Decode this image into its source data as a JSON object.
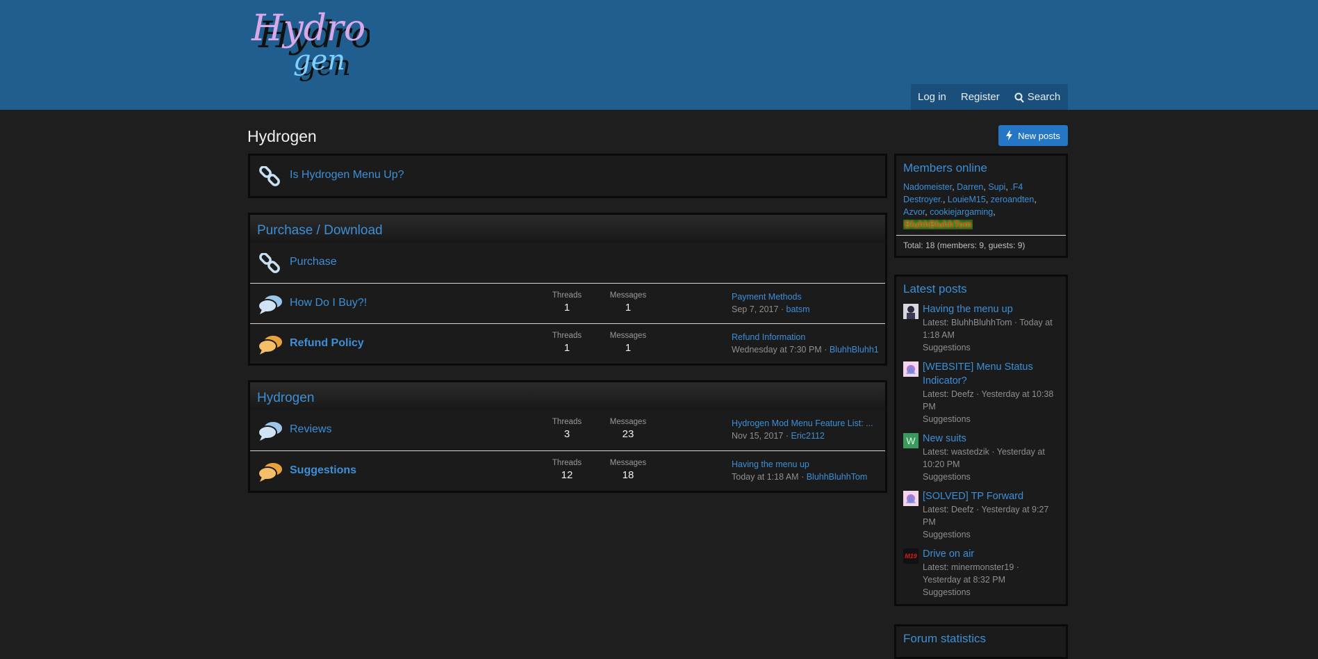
{
  "header": {
    "logo_alt": "Hydrogen",
    "nav": {
      "login": "Log in",
      "register": "Register",
      "search": "Search"
    }
  },
  "page": {
    "title": "Hydrogen",
    "new_posts": "New posts"
  },
  "blocks": [
    {
      "title": "",
      "nodes": [
        {
          "title": "Is Hydrogen Menu Up?",
          "icon": "link-icon",
          "bold": false
        }
      ]
    },
    {
      "title": "Purchase / Download",
      "nodes": [
        {
          "title": "Purchase",
          "icon": "link-icon",
          "bold": false
        },
        {
          "title": "How Do I Buy?!",
          "icon": "chat-bubbles-icon",
          "bold": false,
          "threads_label": "Threads",
          "threads": "1",
          "messages_label": "Messages",
          "messages": "1",
          "latest_title": "Payment Methods",
          "latest_date": "Sep 7, 2017",
          "latest_user": "batsm"
        },
        {
          "title": "Refund Policy",
          "icon": "chat-bubbles-unread-icon",
          "bold": true,
          "threads_label": "Threads",
          "threads": "1",
          "messages_label": "Messages",
          "messages": "1",
          "latest_title": "Refund Information",
          "latest_date": "Wednesday at 7:30 PM",
          "latest_user": "BluhhBluhh1"
        }
      ]
    },
    {
      "title": "Hydrogen",
      "nodes": [
        {
          "title": "Reviews",
          "icon": "chat-bubbles-icon",
          "bold": false,
          "threads_label": "Threads",
          "threads": "3",
          "messages_label": "Messages",
          "messages": "23",
          "latest_title": "Hydrogen Mod Menu Feature List: ...",
          "latest_date": "Nov 15, 2017",
          "latest_user": "Eric2112"
        },
        {
          "title": "Suggestions",
          "icon": "chat-bubbles-unread-icon",
          "bold": true,
          "threads_label": "Threads",
          "threads": "12",
          "messages_label": "Messages",
          "messages": "18",
          "latest_title": "Having the menu up",
          "latest_date": "Today at 1:18 AM",
          "latest_user": "BluhhBluhhTom"
        }
      ]
    }
  ],
  "sidebar": {
    "members_online": {
      "title": "Members online",
      "names": [
        "Nadomeister",
        "Darren",
        "Supi",
        ".F4 Destroyer.",
        "LouieM15",
        "zeroandten",
        "Azvor",
        "cookiejargaming"
      ],
      "highlight": "BluhhBluhhTom",
      "total": "Total: 18 (members: 9, guests: 9)"
    },
    "latest_posts": {
      "title": "Latest posts",
      "items": [
        {
          "title": "Having the menu up",
          "meta": "Latest: BluhhBluhhTom · Today at 1:18 AM",
          "forum": "Suggestions",
          "avatar": "photo"
        },
        {
          "title": "[WEBSITE] Menu Status Indicator?",
          "meta": "Latest: Deefz · Yesterday at 10:38 PM",
          "forum": "Suggestions",
          "avatar": "anime"
        },
        {
          "title": "New suits",
          "meta": "Latest: wastedzik · Yesterday at 10:20 PM",
          "forum": "Suggestions",
          "avatar": "letter",
          "avatar_letter": "W"
        },
        {
          "title": "[SOLVED] TP Forward",
          "meta": "Latest: Deefz · Yesterday at 9:27 PM",
          "forum": "Suggestions",
          "avatar": "anime"
        },
        {
          "title": "Drive on air",
          "meta": "Latest: minermonster19 · Yesterday at 8:32 PM",
          "forum": "Suggestions",
          "avatar": "m19",
          "avatar_text": "M19"
        }
      ]
    },
    "forum_statistics": {
      "title": "Forum statistics"
    }
  },
  "colors": {
    "header": "#1f5e8f",
    "link": "#3d8fd6",
    "background": "#1e1e1f",
    "button": "#2577c6"
  }
}
